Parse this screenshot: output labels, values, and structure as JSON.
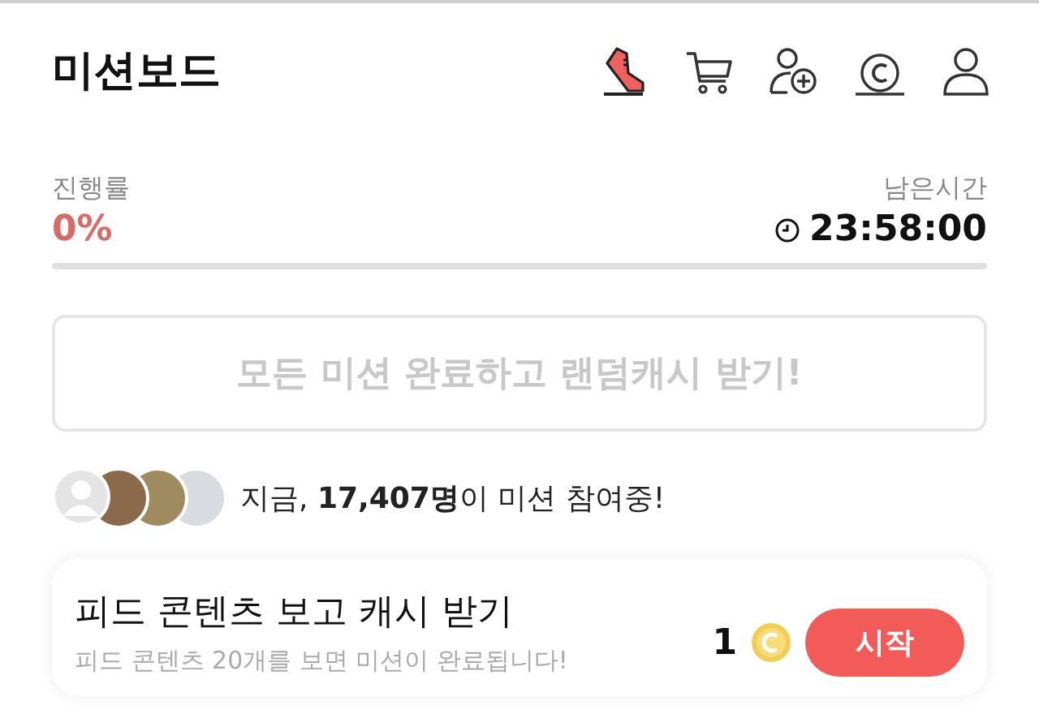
{
  "header": {
    "title": "미션보드"
  },
  "progress": {
    "label": "진행률",
    "value": "0%",
    "level": 0
  },
  "remaining": {
    "label": "남은시간",
    "time": "23:58:00"
  },
  "reward_banner": {
    "text": "모든 미션 완료하고 랜덤캐시 받기!",
    "disabled": true
  },
  "participants": {
    "avatars": [
      {
        "kind": "silhouette"
      },
      {
        "kind": "photo"
      },
      {
        "kind": "photo"
      },
      {
        "kind": "photo"
      }
    ],
    "text": "지금, **17,407명**이 미션 참여중!"
  },
  "missions": [
    {
      "title": "피드 콘텐츠 보고 캐시 받기",
      "description": "피드 콘텐츠 20개를 보면 미션이 완료됩니다!",
      "reward": "1",
      "button": "시작"
    }
  ]
}
